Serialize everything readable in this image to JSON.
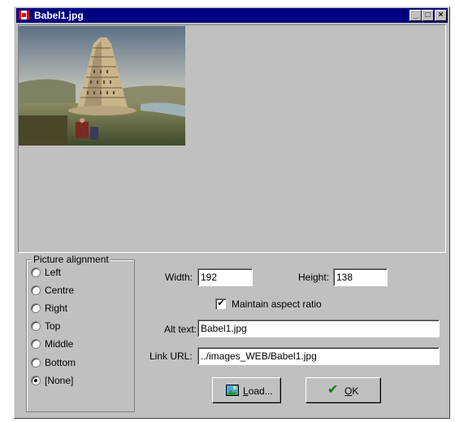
{
  "window": {
    "title": "Babel1.jpg"
  },
  "titlebar_buttons": {
    "minimize": "_",
    "maximize": "□",
    "close": "×"
  },
  "preview": {
    "image": "tower-of-babel-painting"
  },
  "alignment": {
    "legend": "Picture alignment",
    "options": [
      {
        "label": "Left",
        "selected": false
      },
      {
        "label": "Centre",
        "selected": false
      },
      {
        "label": "Right",
        "selected": false
      },
      {
        "label": "Top",
        "selected": false
      },
      {
        "label": "Middle",
        "selected": false
      },
      {
        "label": "Bottom",
        "selected": false
      },
      {
        "label": "[None]",
        "selected": true
      }
    ]
  },
  "size": {
    "width_label": "Width:",
    "width_value": "192",
    "height_label": "Height:",
    "height_value": "138"
  },
  "aspect": {
    "label": "Maintain aspect ratio",
    "checked": true
  },
  "alt": {
    "label": "Alt text:",
    "value": "Babel1.jpg"
  },
  "link": {
    "label": "Link URL:",
    "value": "../images_WEB/Babel1.jpg"
  },
  "buttons": {
    "load": "Load...",
    "ok": "OK"
  }
}
